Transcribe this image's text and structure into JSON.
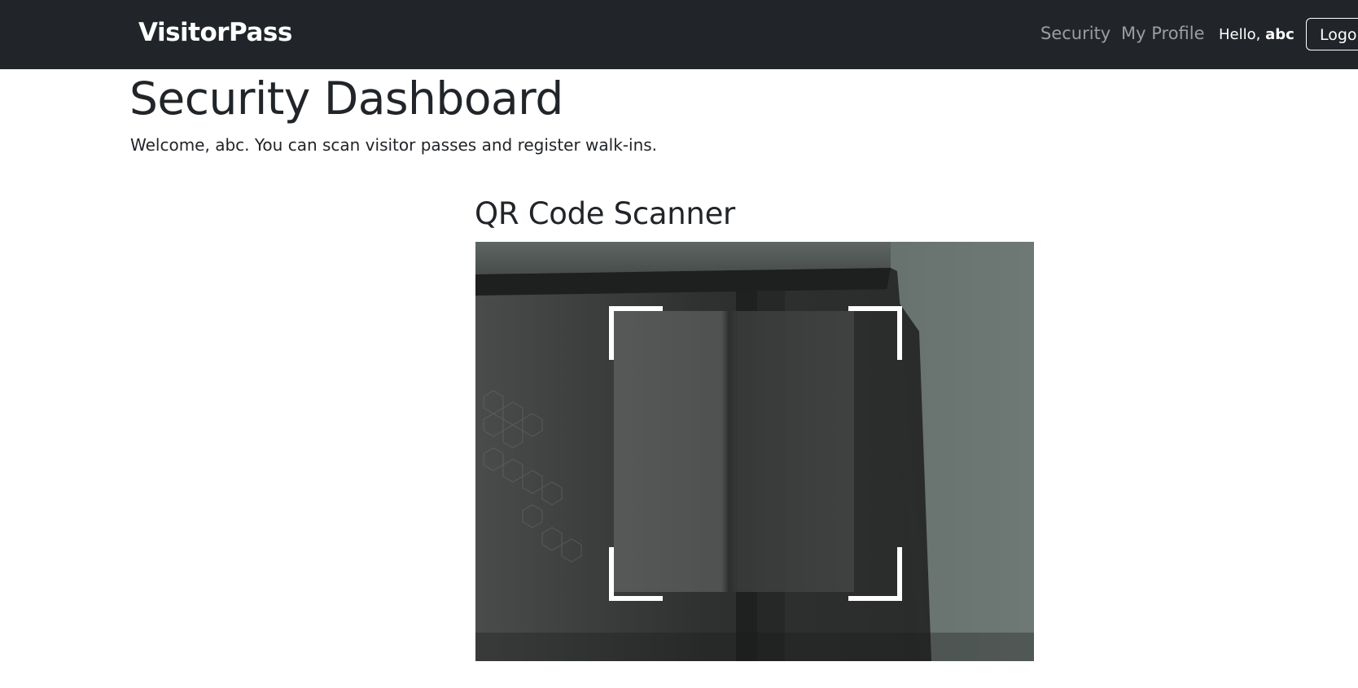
{
  "navbar": {
    "brand": "VisitorPass",
    "links": [
      "Security",
      "My Profile"
    ],
    "greeting": "Hello,",
    "username": "abc",
    "logout_label": "Logout"
  },
  "main": {
    "title": "Security Dashboard",
    "welcome": "Welcome, abc. You can scan visitor passes and register walk-ins."
  },
  "scanner": {
    "title": "QR Code Scanner"
  },
  "colors": {
    "navbar_bg": "#212529",
    "text": "#212529",
    "nav_link": "rgba(255,255,255,0.55)"
  }
}
